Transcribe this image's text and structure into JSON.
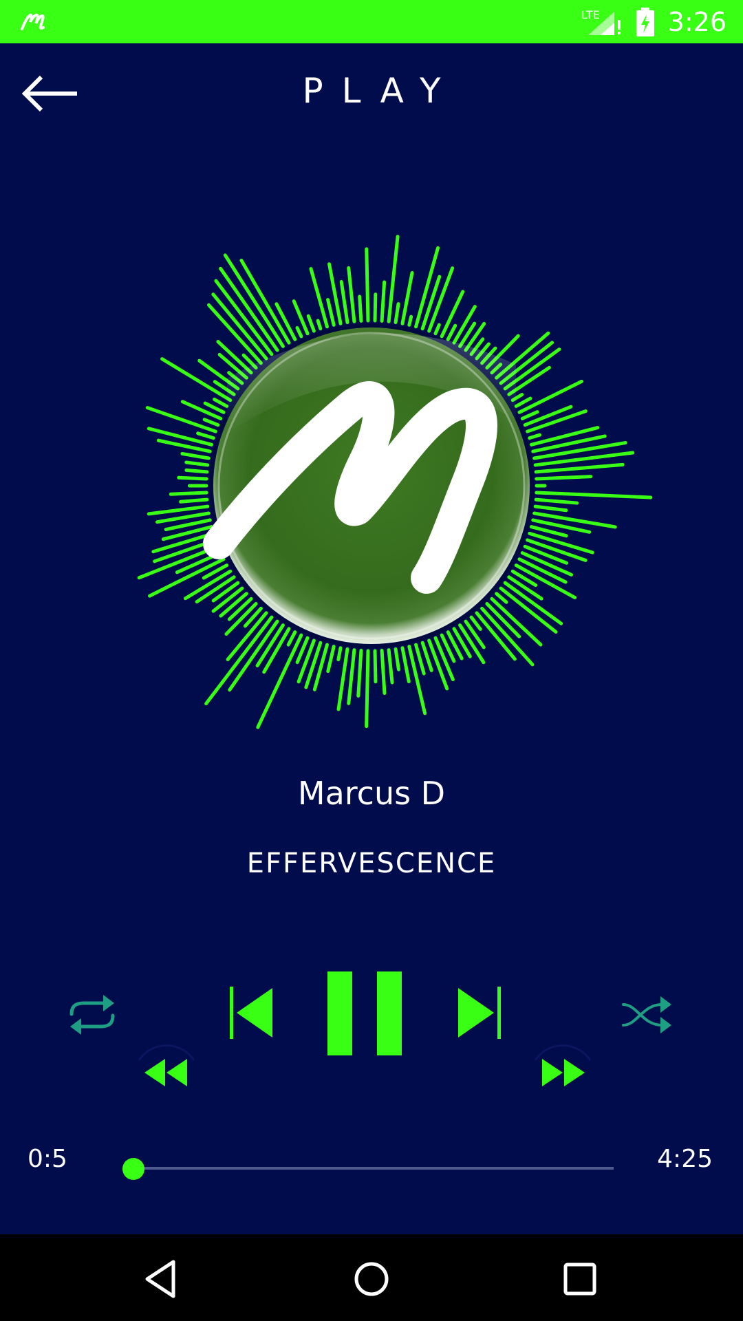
{
  "status_bar": {
    "time": "3:26",
    "network": "LTE",
    "app_icon": "m-logo-icon",
    "background": "#39ff14"
  },
  "header": {
    "title": "PLAY",
    "back_icon": "arrow-left-icon"
  },
  "visualizer": {
    "accent_color": "#39ff14",
    "logo": "M"
  },
  "track": {
    "artist": "Marcus D",
    "title": "EFFERVESCENCE"
  },
  "controls": {
    "repeat_icon": "repeat-icon",
    "previous_icon": "skip-previous-icon",
    "pause_icon": "pause-icon",
    "next_icon": "skip-next-icon",
    "shuffle_icon": "shuffle-icon",
    "rewind_icon": "rewind-icon",
    "forward_icon": "fast-forward-icon",
    "accent_color": "#39ff14",
    "secondary_color": "#1e9e83"
  },
  "progress": {
    "current": "0:5",
    "total": "4:25",
    "fraction": 0.02
  },
  "nav_bar": {
    "back_icon": "nav-back-icon",
    "home_icon": "nav-home-icon",
    "recents_icon": "nav-recents-icon"
  }
}
